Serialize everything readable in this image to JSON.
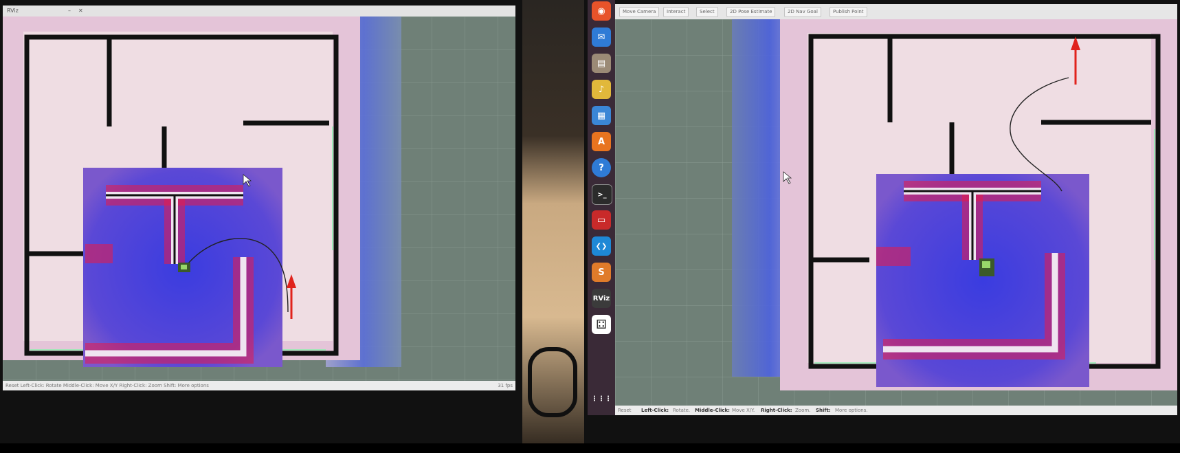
{
  "left_window": {
    "title": "RViz",
    "status_text": "Reset   Left-Click: Rotate  Middle-Click: Move X/Y  Right-Click: Zoom  Shift: More options",
    "fps": "31 fps"
  },
  "right_window": {
    "tabs": [
      "Move Camera",
      "Interact",
      "Select",
      "2D Pose Estimate",
      "2D Nav Goal",
      "Publish Point"
    ],
    "reset_label": "Reset",
    "status_left_click": "Left-Click:",
    "status_left_action": "Rotate.",
    "status_middle_click": "Middle-Click:",
    "status_middle_action": "Move X/Y.",
    "status_right_click": "Right-Click:",
    "status_right_action": "Zoom.",
    "status_shift": "Shift:",
    "status_shift_action": "More options."
  },
  "dock": {
    "items": [
      {
        "name": "firefox-icon",
        "color": "#e8532a",
        "glyph": "◉"
      },
      {
        "name": "thunderbird-icon",
        "color": "#2f7bd6",
        "glyph": "✉"
      },
      {
        "name": "files-icon",
        "color": "#9b8a76",
        "glyph": "▤"
      },
      {
        "name": "rhythmbox-icon",
        "color": "#e1b83b",
        "glyph": "♪"
      },
      {
        "name": "libreoffice-writer-icon",
        "color": "#3a86d6",
        "glyph": "▦"
      },
      {
        "name": "software-center-icon",
        "color": "#e8741f",
        "glyph": "A"
      },
      {
        "name": "help-icon",
        "color": "#2f7bd6",
        "glyph": "?"
      },
      {
        "name": "terminal-icon",
        "color": "#2b2b2b",
        "glyph": ">_"
      },
      {
        "name": "system-monitor-icon",
        "color": "#c92a2a",
        "glyph": "▭"
      },
      {
        "name": "vscode-icon",
        "color": "#1e88d6",
        "glyph": "❮❯"
      },
      {
        "name": "sublime-icon",
        "color": "#e07b2a",
        "glyph": "S"
      },
      {
        "name": "rviz-icon",
        "color": "#3b3b3b",
        "glyph": "RViz"
      },
      {
        "name": "apps-icon",
        "color": "#ffffff",
        "glyph": "⚃"
      }
    ],
    "show_apps": "⋮⋮⋮"
  },
  "colors": {
    "map_free": "#eccfd7",
    "map_wall": "#1a1a1a",
    "costmap_blue": "#3c3ee0",
    "costmap_red": "#e81a4a",
    "grid_bg": "#6f8077",
    "goal_arrow": "#e0221c"
  }
}
